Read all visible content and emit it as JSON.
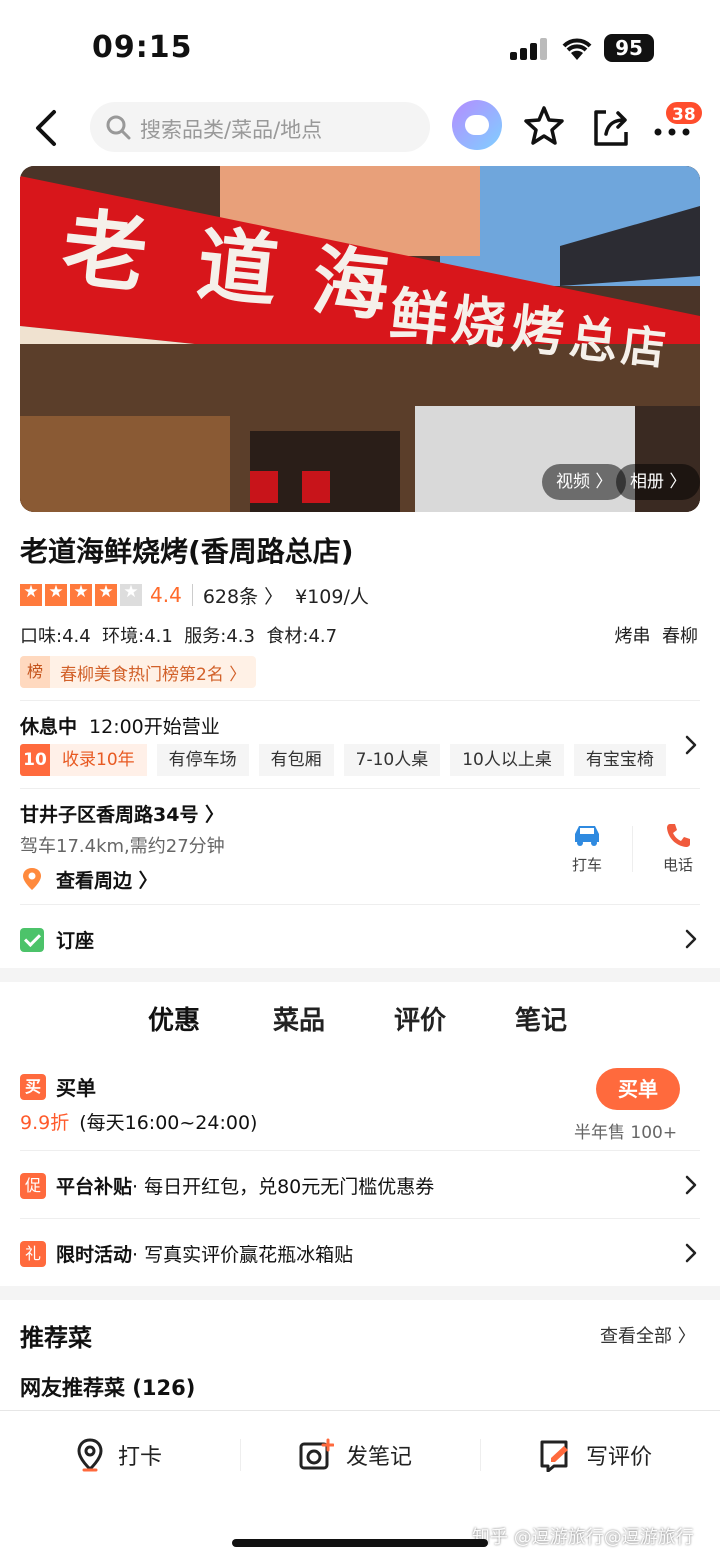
{
  "status_bar": {
    "time": "09:15",
    "battery": "95"
  },
  "nav": {
    "search_placeholder": "搜索品类/菜品/地点",
    "notification_count": "38"
  },
  "hero": {
    "video_label": "视频 〉",
    "album_label": "相册 〉",
    "sign_text": "老道海鲜烧烤总店"
  },
  "shop": {
    "name": "老道海鲜烧烤(香周路总店)",
    "rating": "4.4",
    "review_count": "628条 〉",
    "price_per_person": "¥109/人",
    "sub_scores": "口味:4.4  环境:4.1  服务:4.3  食材:4.7",
    "categories": "烤串  春柳",
    "rank_icon": "榜",
    "rank_text": "春柳美食热门榜第2名 〉"
  },
  "hours": {
    "status": "休息中",
    "open_text": "12:00开始营业"
  },
  "facilities": {
    "years_badge": "10",
    "items": [
      "收录10年",
      "有停车场",
      "有包厢",
      "7-10人桌",
      "10人以上桌",
      "有宝宝椅"
    ]
  },
  "location": {
    "address": "甘井子区香周路34号 〉",
    "drive": "驾车17.4km,需约27分钟",
    "nearby": "查看周边 〉",
    "taxi_label": "打车",
    "phone_label": "电话"
  },
  "booking": {
    "label": "订座"
  },
  "tabs": [
    "优惠",
    "菜品",
    "评价",
    "笔记"
  ],
  "deals": {
    "buy_icon": "买",
    "buy_title": "买单",
    "discount": "9.9折",
    "discount_time": "(每天16:00~24:00)",
    "buy_button": "买单",
    "sold": "半年售 100+",
    "promos": [
      {
        "icon": "促",
        "title": "平台补贴",
        "text": " · 每日开红包，兑80元无门槛优惠券"
      },
      {
        "icon": "礼",
        "title": "限时活动",
        "text": " · 写真实评价赢花瓶冰箱贴"
      }
    ]
  },
  "recommend": {
    "title": "推荐菜",
    "see_all": "查看全部 〉",
    "subtitle": "网友推荐菜 (126)"
  },
  "bottom_bar": {
    "checkin": "打卡",
    "note": "发笔记",
    "review": "写评价"
  },
  "watermark": "知乎 @逗游旅行@逗游旅行"
}
